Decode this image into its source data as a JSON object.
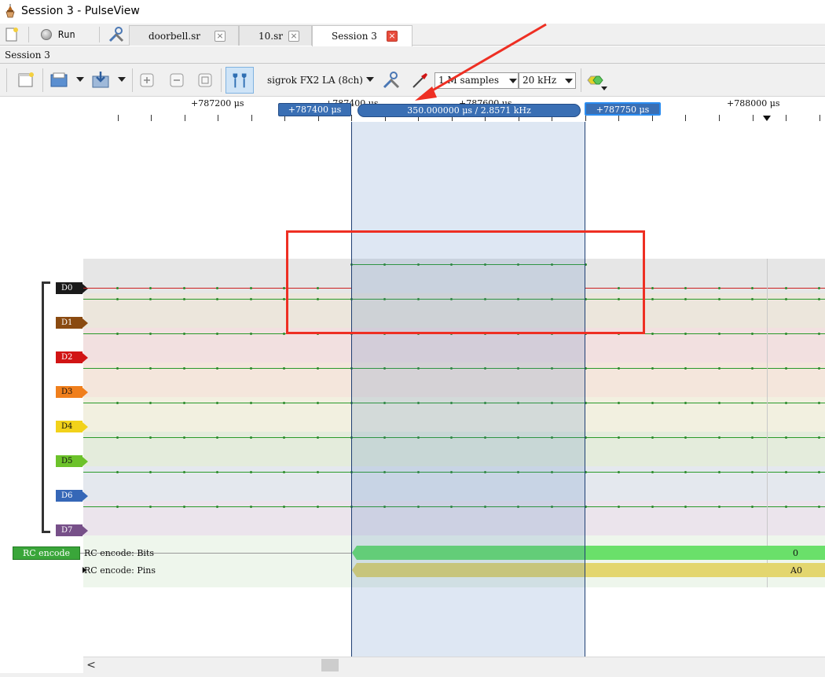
{
  "window": {
    "title": "Session 3 - PulseView"
  },
  "tabbar": {
    "run_label": "Run",
    "tabs": [
      {
        "label": "doorbell.sr",
        "close": "×"
      },
      {
        "label": "10.sr",
        "close": "×"
      },
      {
        "label": "Session 3",
        "close": "×"
      }
    ]
  },
  "session": {
    "label": "Session 3"
  },
  "toolbar": {
    "device": "sigrok FX2 LA (8ch)",
    "samples": "1 M samples",
    "samplerate": "20 kHz"
  },
  "ruler": {
    "labels": [
      "+787200 μs",
      "+787400 μs",
      "+787600 μs",
      "+788000 μs"
    ],
    "cursor_a": "+787400 μs",
    "cursor_b": "+787750 μs",
    "cursor_range": "350.000000 μs / 2.8571 kHz"
  },
  "channels": [
    {
      "name": "D0",
      "color": "#1a1a1a"
    },
    {
      "name": "D1",
      "color": "#8a4a10"
    },
    {
      "name": "D2",
      "color": "#d11414"
    },
    {
      "name": "D3",
      "color": "#f07f1c"
    },
    {
      "name": "D4",
      "color": "#f2d21a"
    },
    {
      "name": "D5",
      "color": "#6cc22a"
    },
    {
      "name": "D6",
      "color": "#3567b7"
    },
    {
      "name": "D7",
      "color": "#775089"
    }
  ],
  "decoder": {
    "label": "RC encode",
    "rows": [
      {
        "label": "RC encode: Bits",
        "value": "0",
        "color": "#6ae06a"
      },
      {
        "label": "RC encode: Pins",
        "value": "A0",
        "color": "#e3d66e"
      }
    ]
  },
  "scroll": {
    "left_arrow": "<"
  }
}
